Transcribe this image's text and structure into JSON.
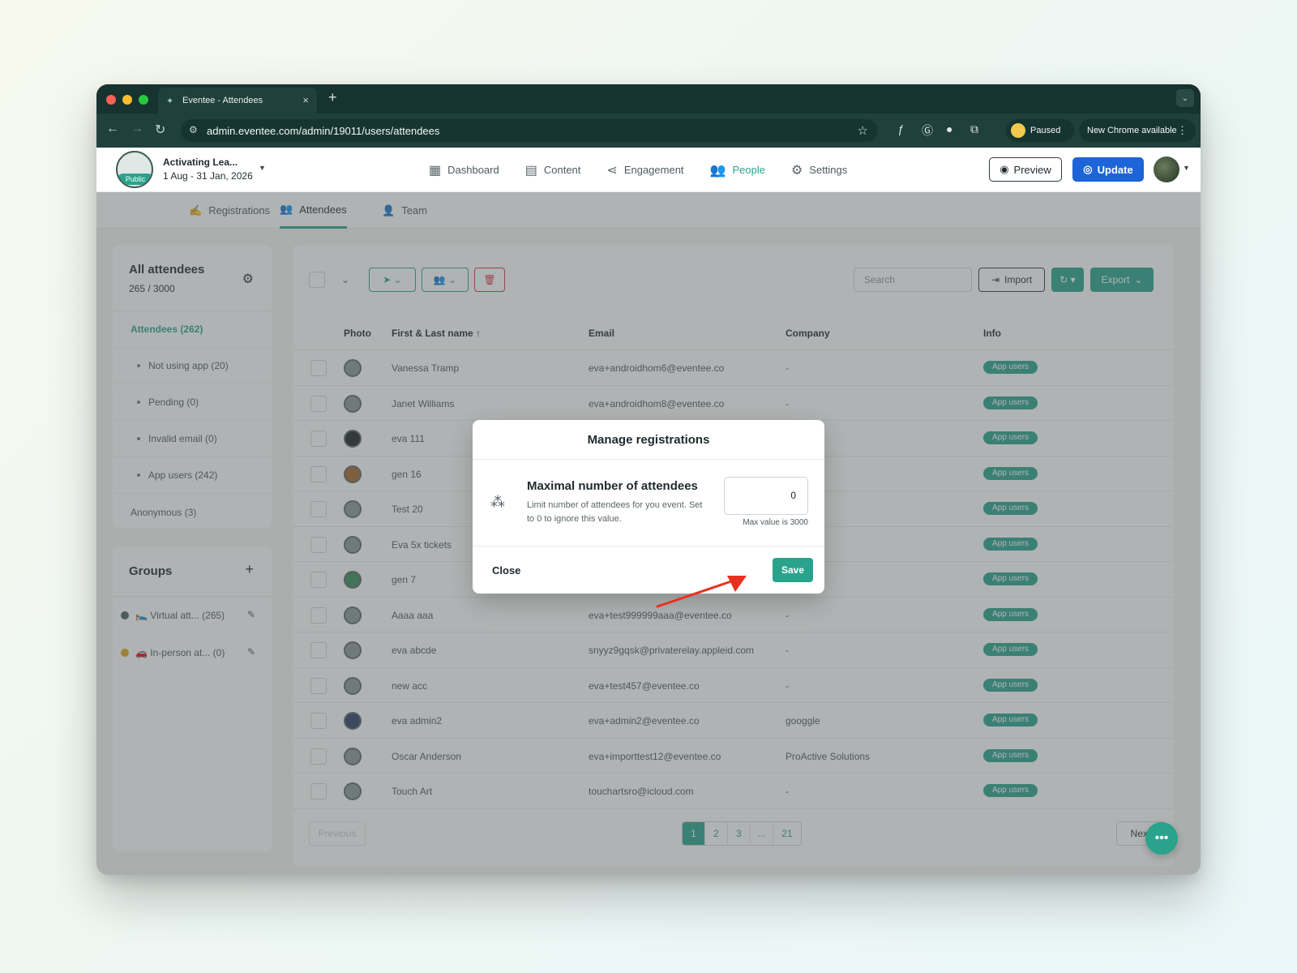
{
  "browser": {
    "tab_title": "Eventee - Attendees",
    "url": "admin.eventee.com/admin/19011/users/attendees",
    "paused_label": "Paused",
    "new_chrome_label": "New Chrome available"
  },
  "header": {
    "event_name": "Activating Lea...",
    "event_dates": "1 Aug - 31 Jan, 2026",
    "visibility_badge": "Public",
    "nav": [
      {
        "label": "Dashboard",
        "icon": "dashboard-icon"
      },
      {
        "label": "Content",
        "icon": "content-icon"
      },
      {
        "label": "Engagement",
        "icon": "share-icon"
      },
      {
        "label": "People",
        "icon": "people-icon",
        "active": true
      },
      {
        "label": "Settings",
        "icon": "gear-icon"
      }
    ],
    "preview_label": "Preview",
    "update_label": "Update"
  },
  "subnav": {
    "registrations": "Registrations",
    "attendees": "Attendees",
    "team": "Team"
  },
  "sidebar": {
    "title": "All attendees",
    "count": "265 / 3000",
    "items": [
      "Attendees (262)",
      "Not using app (20)",
      "Pending (0)",
      "Invalid email (0)",
      "App users (242)",
      "Anonymous (3)"
    ]
  },
  "groups": {
    "title": "Groups",
    "items": [
      {
        "label": "🛌 Virtual att... (265)",
        "color": "#555f61"
      },
      {
        "label": "🚗 In-person at... (0)",
        "color": "#e0a21b"
      }
    ]
  },
  "table": {
    "search_placeholder": "Search",
    "import_label": "Import",
    "export_label": "Export",
    "columns": [
      "Photo",
      "First & Last name ↑",
      "Email",
      "Company",
      "Info"
    ],
    "rows": [
      {
        "name": "Vanessa Tramp",
        "email": "eva+androidhom6@eventee.co",
        "company": "-",
        "info": "App users"
      },
      {
        "name": "Janet Williams",
        "email": "eva+androidhom8@eventee.co",
        "company": "-",
        "info": "App users"
      },
      {
        "name": "eva 111",
        "email": "",
        "company": "",
        "info": "App users"
      },
      {
        "name": "gen 16",
        "email": "",
        "company": "",
        "info": "App users"
      },
      {
        "name": "Test 20",
        "email": "",
        "company": "",
        "info": "App users"
      },
      {
        "name": "Eva 5x tickets",
        "email": "",
        "company": "",
        "info": "App users"
      },
      {
        "name": "gen 7",
        "email": "",
        "company": "",
        "info": "App users"
      },
      {
        "name": "Aaaa aaa",
        "email": "eva+test999999aaa@eventee.co",
        "company": "-",
        "info": "App users"
      },
      {
        "name": "eva abcde",
        "email": "snyyz9gqsk@privaterelay.appleid.com",
        "company": "-",
        "info": "App users"
      },
      {
        "name": "new acc",
        "email": "eva+test457@eventee.co",
        "company": "-",
        "info": "App users"
      },
      {
        "name": "eva admin2",
        "email": "eva+admin2@eventee.co",
        "company": "googgle",
        "info": "App users"
      },
      {
        "name": "Oscar Anderson",
        "email": "eva+importtest12@eventee.co",
        "company": "ProActive Solutions",
        "info": "App users"
      },
      {
        "name": "Touch Art",
        "email": "touchartsro@icloud.com",
        "company": "-",
        "info": "App users"
      }
    ],
    "pagination": {
      "previous": "Previous",
      "pages": [
        "1",
        "2",
        "3",
        "...",
        "21"
      ],
      "next": "Next"
    }
  },
  "modal": {
    "title": "Manage registrations",
    "field_label": "Maximal number of attendees",
    "field_description": "Limit number of attendees for you event. Set to 0 to ignore this value.",
    "field_value": "0",
    "field_hint": "Max value is 3000",
    "close_label": "Close",
    "save_label": "Save"
  },
  "colors": {
    "accent": "#2aa38c",
    "update_button": "#1d64d8",
    "delete_button": "#d9364a",
    "annotation_arrow": "#e8321f"
  }
}
